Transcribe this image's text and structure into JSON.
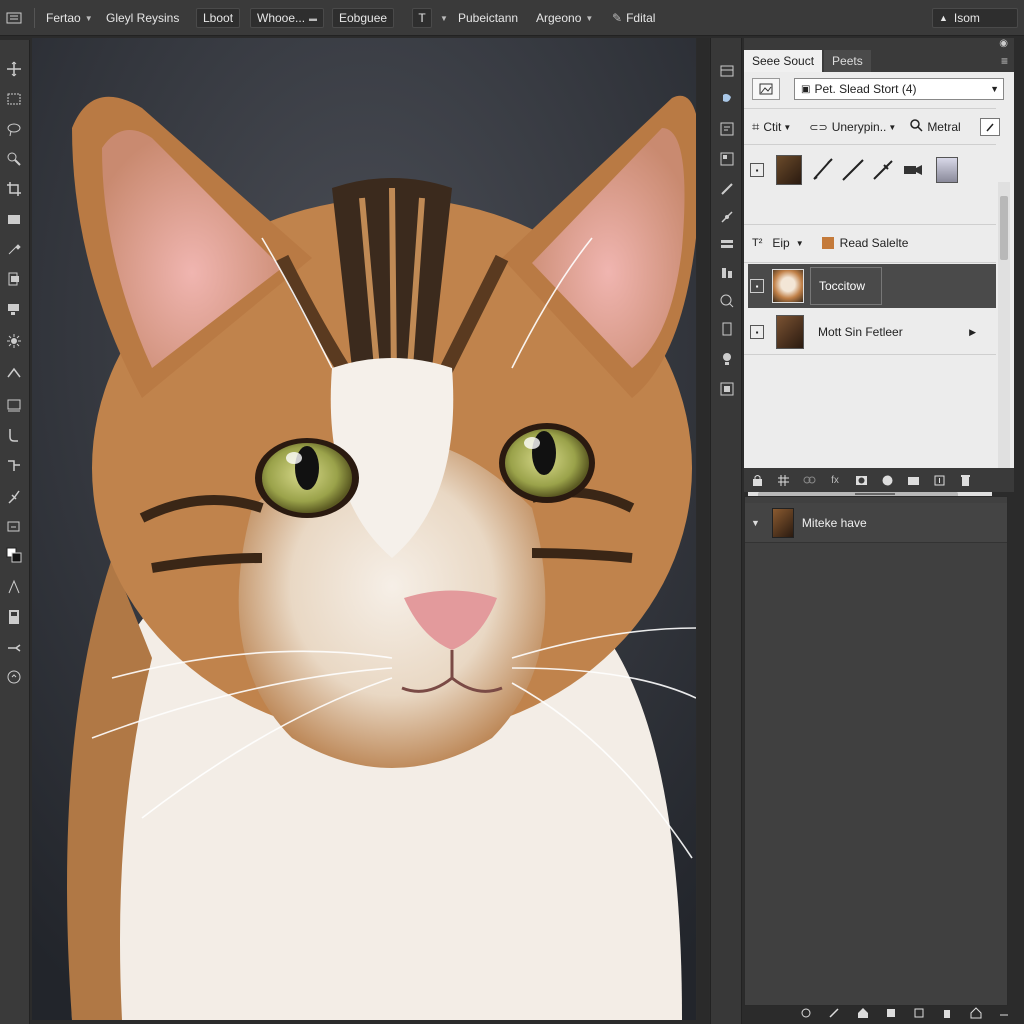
{
  "topbar": {
    "items": [
      "Fertao",
      "Gleyl Reysins",
      "Lboot",
      "Whooe...",
      "Eobguee",
      "T",
      "Pubeictann",
      "Argeono",
      "Fdital"
    ],
    "right_label": "Isom"
  },
  "panel": {
    "tabs": [
      "Seee Souct",
      "Peets"
    ],
    "preset_value": "Pet. Slead Stort (4)",
    "row2": {
      "cut": "Ctit",
      "kind": "Unerypin..",
      "search": "Metral"
    },
    "row_bf": {
      "label1": "Eip",
      "label2": "Read Salelte"
    },
    "layers": [
      {
        "name": "Toccitow",
        "selected": true
      },
      {
        "name": "Mott Sin Fetleer",
        "selected": false
      }
    ]
  },
  "lower_panel": {
    "row_label": "Miteke have"
  },
  "colors": {
    "accent": "#4a4a4a",
    "panel_light": "#ececec",
    "ui_dark": "#3a3a3a"
  }
}
